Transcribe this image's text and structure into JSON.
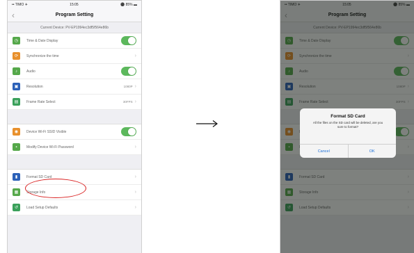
{
  "status_bar": {
    "carrier": "•• TIMO ✈",
    "time": "15:05",
    "battery": "⚫ 85% ▬"
  },
  "nav": {
    "title": "Program Setting",
    "back": "‹"
  },
  "device": "Current Device: PV-EP1994ec3df5f564e86b",
  "group1": [
    {
      "label": "Time & Date Display",
      "icon": "clock-icon",
      "color": "#55a84a",
      "control": "toggle"
    },
    {
      "label": "Synchronize the time",
      "icon": "sync-icon",
      "color": "#e8902c",
      "control": "chevron"
    },
    {
      "label": "Audio",
      "icon": "audio-icon",
      "color": "#55a84a",
      "control": "toggle"
    },
    {
      "label": "Resolution",
      "icon": "resolution-icon",
      "color": "#2c61b8",
      "control": "chevron",
      "value": "1080P"
    },
    {
      "label": "Frame Rate Select",
      "icon": "frame-rate-icon",
      "color": "#3aa05a",
      "control": "chevron",
      "value": "30FPS"
    }
  ],
  "group2": [
    {
      "label": "Device Wi-Fi SSID Visible",
      "icon": "wifi-icon",
      "color": "#e8902c",
      "control": "toggle"
    },
    {
      "label": "Modify Device Wi-Fi Password",
      "icon": "lock-icon",
      "color": "#55a84a",
      "control": "chevron"
    }
  ],
  "group3": [
    {
      "label": "Format SD Card",
      "icon": "sd-card-icon",
      "color": "#2c61b8",
      "control": "chevron"
    },
    {
      "label": "Storage Info",
      "icon": "storage-icon",
      "color": "#55a84a",
      "control": "chevron"
    },
    {
      "label": "Load Setup Defaults",
      "icon": "defaults-icon",
      "color": "#3aa05a",
      "control": "chevron"
    }
  ],
  "dialog": {
    "title": "Format SD Card",
    "message": "All the files on the SD card will be deleted, are you sure to format?",
    "cancel": "Cancel",
    "ok": "OK"
  },
  "arrow": "→"
}
